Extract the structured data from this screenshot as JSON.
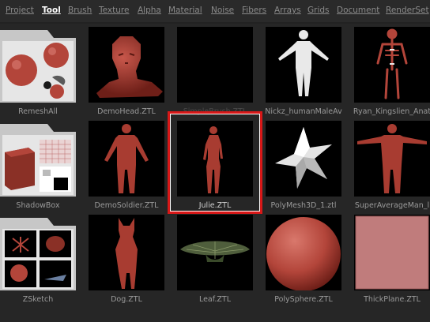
{
  "menu": {
    "items": [
      "Project",
      "Tool",
      "Brush",
      "Texture",
      "Alpha",
      "Material",
      "Noise",
      "Fibers",
      "Arrays",
      "Grids",
      "Document",
      "RenderSet"
    ],
    "active": "Tool"
  },
  "tiles": [
    {
      "label": "RemeshAll",
      "kind": "folder",
      "icon": "remesh-folder-icon"
    },
    {
      "label": "DemoHead.ZTL",
      "kind": "mesh",
      "icon": "demo-head-icon"
    },
    {
      "label": "SimpleBrush.ZTL",
      "kind": "mesh",
      "icon": "simple-brush-icon"
    },
    {
      "label": "Nickz_humanMaleAv",
      "kind": "mesh",
      "icon": "male-figure-icon"
    },
    {
      "label": "Ryan_Kingslien_Anat",
      "kind": "mesh",
      "icon": "skeleton-figure-icon"
    },
    {
      "label": "ShadowBox",
      "kind": "folder",
      "icon": "shadowbox-folder-icon"
    },
    {
      "label": "DemoSoldier.ZTL",
      "kind": "mesh",
      "icon": "soldier-figure-icon"
    },
    {
      "label": "Julie.ZTL",
      "kind": "mesh",
      "icon": "female-figure-icon",
      "selected": true
    },
    {
      "label": "PolyMesh3D_1.ztl",
      "kind": "mesh",
      "icon": "star-mesh-icon"
    },
    {
      "label": "SuperAverageMan_l",
      "kind": "mesh",
      "icon": "average-man-icon"
    },
    {
      "label": "ZSketch",
      "kind": "folder",
      "icon": "zsketch-folder-icon"
    },
    {
      "label": "Dog.ZTL",
      "kind": "mesh",
      "icon": "dog-figure-icon"
    },
    {
      "label": "Leaf.ZTL",
      "kind": "mesh",
      "icon": "leaf-mesh-icon"
    },
    {
      "label": "PolySphere.ZTL",
      "kind": "mesh",
      "icon": "sphere-mesh-icon"
    },
    {
      "label": "ThickPlane.ZTL",
      "kind": "mesh",
      "icon": "plane-mesh-icon"
    }
  ],
  "colors": {
    "clay": "#b3453a",
    "clay_dark": "#6e1f18",
    "selection": "#d81818",
    "plane": "#c07c7c"
  }
}
